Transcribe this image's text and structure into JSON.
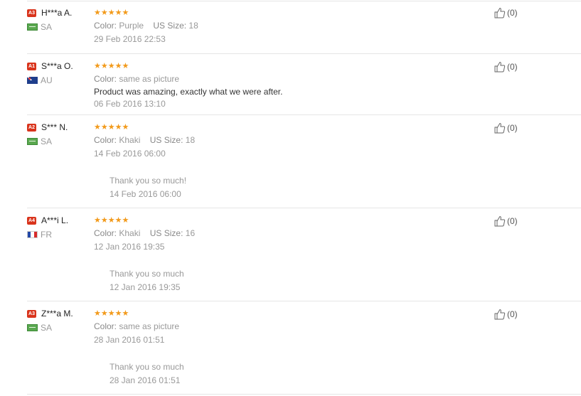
{
  "reviews": [
    {
      "level": "A3",
      "name": "H***a A.",
      "country": "SA",
      "flag": "sa-flag-icon",
      "stars": "★★★★★",
      "attrs": [
        {
          "k": "Color:",
          "v": "Purple"
        },
        {
          "k": "US Size:",
          "v": "18"
        }
      ],
      "feedback": "",
      "date": "29 Feb 2016 22:53",
      "reply": null,
      "helpful": "(0)"
    },
    {
      "level": "A1",
      "name": "S***a O.",
      "country": "AU",
      "flag": "au-flag-icon",
      "stars": "★★★★★",
      "attrs": [
        {
          "k": "Color:",
          "v": "same as picture"
        }
      ],
      "feedback": "Product was amazing, exactly what we were after.",
      "date": "06 Feb 2016 13:10",
      "reply": null,
      "helpful": "(0)"
    },
    {
      "level": "A2",
      "name": "S*** N.",
      "country": "SA",
      "flag": "sa-flag-icon",
      "stars": "★★★★★",
      "attrs": [
        {
          "k": "Color:",
          "v": "Khaki"
        },
        {
          "k": "US Size:",
          "v": "18"
        }
      ],
      "feedback": "",
      "date": "14 Feb 2016 06:00",
      "reply": {
        "text": "Thank you so much!",
        "date": "14 Feb 2016 06:00"
      },
      "helpful": "(0)"
    },
    {
      "level": "A4",
      "name": "A***i L.",
      "country": "FR",
      "flag": "fr-flag-icon",
      "stars": "★★★★★",
      "attrs": [
        {
          "k": "Color:",
          "v": "Khaki"
        },
        {
          "k": "US Size:",
          "v": "16"
        }
      ],
      "feedback": "",
      "date": "12 Jan 2016 19:35",
      "reply": {
        "text": "Thank you so much",
        "date": "12 Jan 2016 19:35"
      },
      "helpful": "(0)"
    },
    {
      "level": "A3",
      "name": "Z***a M.",
      "country": "SA",
      "flag": "sa-flag-icon",
      "stars": "★★★★★",
      "attrs": [
        {
          "k": "Color:",
          "v": "same as picture"
        }
      ],
      "feedback": "",
      "date": "28 Jan 2016 01:51",
      "reply": {
        "text": "Thank you so much",
        "date": "28 Jan 2016 01:51"
      },
      "helpful": "(0)"
    }
  ],
  "colors": {
    "star": "#f29a1b",
    "level_badge": "#d9341c",
    "muted_text": "#999999"
  }
}
